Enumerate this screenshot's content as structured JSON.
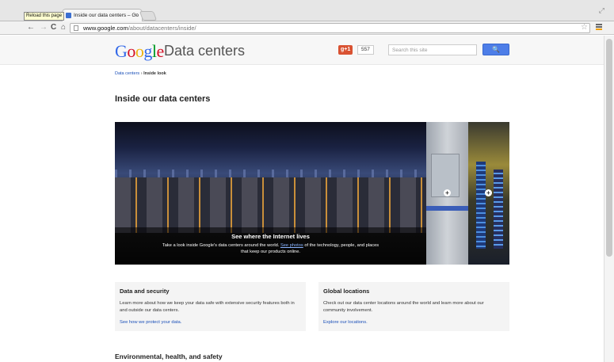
{
  "browser": {
    "tooltip": "Reload this page",
    "tab_title": "Inside our data centers – Go",
    "tab_close": "×",
    "nav_back": "←",
    "nav_forward": "→",
    "nav_reload": "C",
    "nav_home": "⌂",
    "url_host": "www.google.com",
    "url_path": "/about/datacenters/inside/",
    "star": "☆"
  },
  "header": {
    "logo_letters": [
      "G",
      "o",
      "o",
      "g",
      "l",
      "e"
    ],
    "site_name": "Data centers",
    "plusone_label": "+1",
    "plusone_count": "557",
    "search_placeholder": "Search this site",
    "search_button": "🔍"
  },
  "breadcrumb": {
    "parent": "Data centers",
    "separator": "›",
    "current": "Inside look"
  },
  "page_title": "Inside our data centers",
  "hero": {
    "caption_title": "See where the Internet lives",
    "caption_before": "Take a look inside Google's data centers around the world.",
    "caption_link": "See photos",
    "caption_after": "of the technology, people, and places that keep our products online.",
    "expand_icon": "+"
  },
  "cards": [
    {
      "title": "Data and security",
      "body": "Learn more about how we keep your data safe with extensive security features both in and outside our data centers.",
      "link": "See how we protect your data."
    },
    {
      "title": "Global locations",
      "body": "Check out our data center locations around the world and learn more about our community involvement.",
      "link": "Explore our locations."
    }
  ],
  "section_heading": "Environmental, health, and safety",
  "colors": {
    "link": "#1a4fb8",
    "search_button": "#4d7ee8",
    "plusone": "#d95232"
  }
}
